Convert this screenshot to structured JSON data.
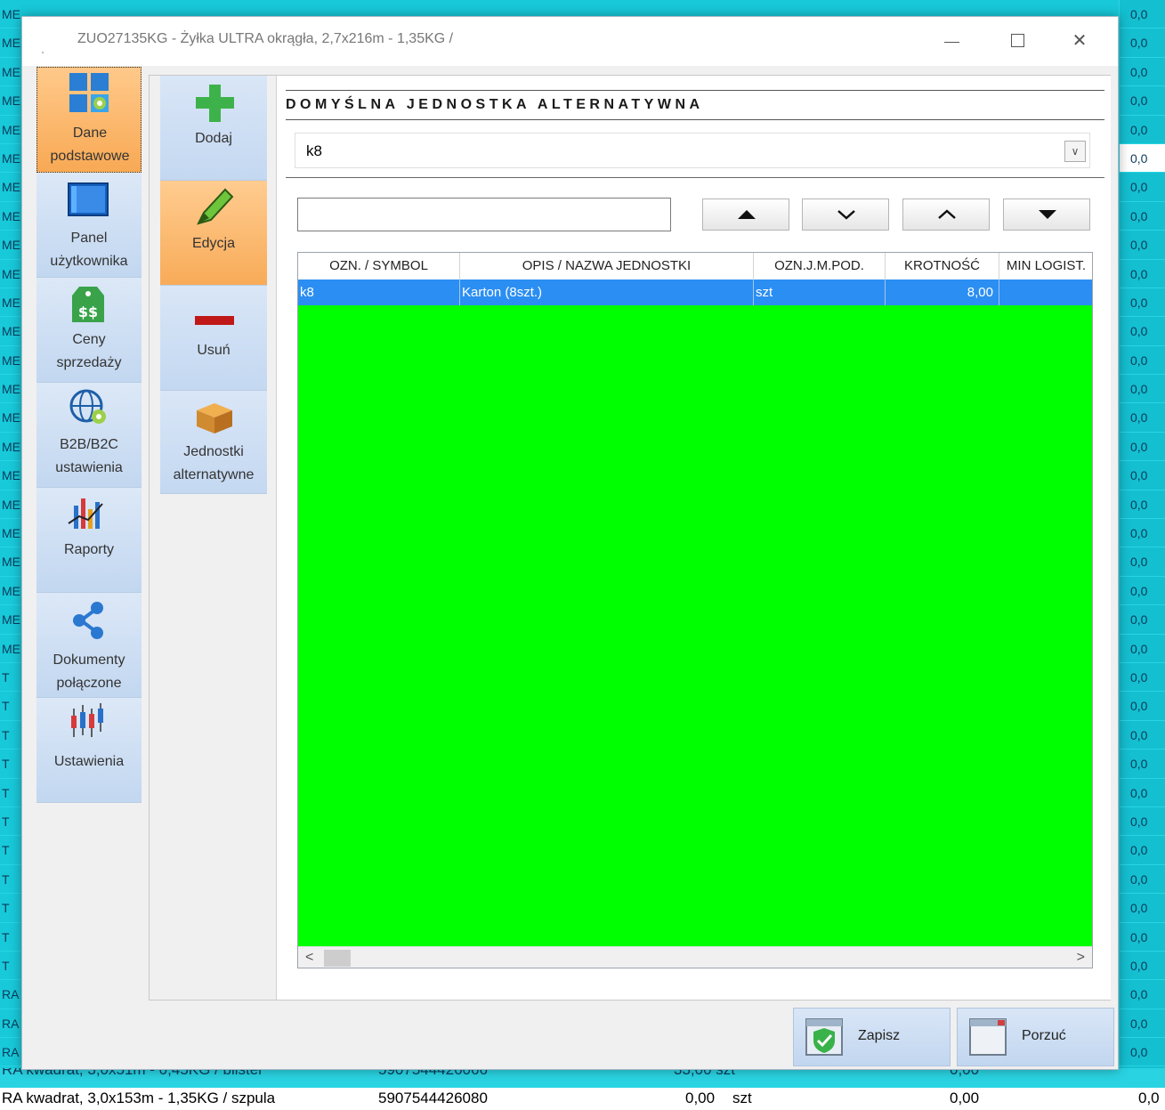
{
  "window": {
    "title": "ZUO27135KG - Żyłka ULTRA okrągła, 2,7x216m - 1,35KG /"
  },
  "nav": [
    {
      "label1": "Dane",
      "label2": "podstawowe",
      "icon": "grid-gear-icon"
    },
    {
      "label1": "Panel",
      "label2": "użytkownika",
      "icon": "window-panel-icon"
    },
    {
      "label1": "Ceny",
      "label2": "sprzedaży",
      "icon": "price-tag-icon"
    },
    {
      "label1": "B2B/B2C",
      "label2": "ustawienia",
      "icon": "globe-gear-icon"
    },
    {
      "label1": "Raporty",
      "label2": "",
      "icon": "chart-icon"
    },
    {
      "label1": "Dokumenty",
      "label2": "połączone",
      "icon": "share-icon"
    },
    {
      "label1": "Ustawienia",
      "label2": "",
      "icon": "candlestick-icon"
    }
  ],
  "actions": [
    {
      "label1": "Dodaj",
      "label2": "",
      "icon": "plus-icon"
    },
    {
      "label1": "Edycja",
      "label2": "",
      "icon": "marker-icon"
    },
    {
      "label1": "Usuń",
      "label2": "",
      "icon": "minus-icon"
    },
    {
      "label1": "Jednostki",
      "label2": "alternatywne",
      "icon": "box-icon"
    }
  ],
  "section": {
    "title": "DOMYŚLNA JEDNOSTKA ALTERNATYWNA"
  },
  "combo": {
    "value": "k8"
  },
  "search": {
    "value": ""
  },
  "grid": {
    "columns": [
      "OZN. / SYMBOL",
      "OPIS / NAZWA JEDNOSTKI",
      "OZN.J.M.POD.",
      "KROTNOŚĆ",
      "MIN LOGIST."
    ],
    "rows": [
      [
        "k8",
        "Karton (8szt.)",
        "szt",
        "8,00",
        ""
      ]
    ]
  },
  "buttons": {
    "save": "Zapisz",
    "discard": "Porzuć"
  },
  "background": {
    "left_rows": [
      "ME",
      "ME",
      "ME",
      "ME",
      "ME",
      "ME",
      "ME",
      "ME",
      "ME",
      "ME",
      "ME",
      "ME",
      "ME",
      "ME",
      "ME",
      "ME",
      "ME",
      "ME",
      "ME",
      "ME",
      "ME",
      "ME",
      "ME",
      "T",
      "T",
      "T",
      "T",
      "T",
      "T",
      "T",
      "T",
      "T",
      "T",
      "T",
      "RA",
      "RA",
      "RA"
    ],
    "right_rows": [
      "0,0",
      "0,0",
      "0,0",
      "0,0",
      "0,0",
      "0,0",
      "0,0",
      "0,0",
      "0,0",
      "0,0",
      "0,0",
      "0,0",
      "0,0",
      "0,0",
      "0,0",
      "0,0",
      "0,0",
      "0,0",
      "0,0",
      "0,0",
      "0,0",
      "0,0",
      "0,0",
      "0,0",
      "0,0",
      "0,0",
      "0,0",
      "0,0",
      "0,0",
      "0,0",
      "0,0",
      "0,0",
      "0,0",
      "0,0",
      "0,0",
      "0,0",
      "0,0",
      "0,0"
    ],
    "prev_row": {
      "name": "RA kwadrat, 3,0x51m - 0,45KG / blister",
      "ean": "5907544426066",
      "qty": "33,00 szt",
      "val": "0,00"
    },
    "last_row": {
      "name": "RA kwadrat, 3,0x153m - 1,35KG / szpula",
      "ean": "5907544426080",
      "qty": "0,00",
      "unit": "szt",
      "val": "0,00",
      "val2": "0,0"
    }
  },
  "colors": {
    "accent": "#2b8ef2",
    "grid_bg": "#00ff00",
    "active": "#f8a954",
    "desktop": "#18c9d9"
  }
}
